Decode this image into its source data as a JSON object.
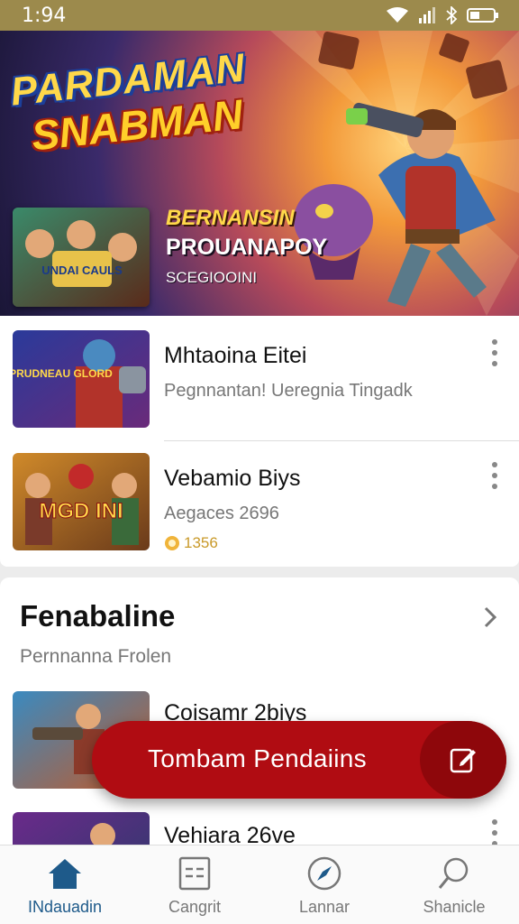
{
  "status_bar": {
    "time": "1:94"
  },
  "hero": {
    "title_line1": "PARDAMAN",
    "title_line2": "SNABMAN",
    "thumb_text": "UNDAI CAULS",
    "subtitle1": "BERNANSIN",
    "subtitle2": "PROUANAPOY",
    "subtitle3": "SCEGIOOINI"
  },
  "list": {
    "items": [
      {
        "title": "Mhtaoina Eitei",
        "subtitle": "Pegnnantan! Ueregnia Tingadk",
        "thumb_text": "DERMA PRUDNEAU GLORD"
      },
      {
        "title": "Vebamio Biys",
        "subtitle": "Aegaces 2696",
        "meta": "1356",
        "thumb_text": "MGD INI"
      }
    ]
  },
  "section": {
    "heading": "Fenabaline",
    "subheading": "Pernnanna Frolen",
    "items": [
      {
        "title": "Coisamr 2biys"
      },
      {
        "title": "Vehiara 26ve"
      }
    ]
  },
  "fab": {
    "label": "Tombam Pendaiins"
  },
  "bottom_nav": {
    "items": [
      {
        "label": "INdauadin",
        "icon": "home-icon",
        "active": true
      },
      {
        "label": "Cangrit",
        "icon": "list-icon"
      },
      {
        "label": "Lannar",
        "icon": "compass-icon"
      },
      {
        "label": "Shanicle",
        "icon": "search-icon"
      }
    ]
  },
  "colors": {
    "status_bar": "#9c8a4c",
    "accent": "#b00c12",
    "nav_active": "#1e5a8a"
  }
}
